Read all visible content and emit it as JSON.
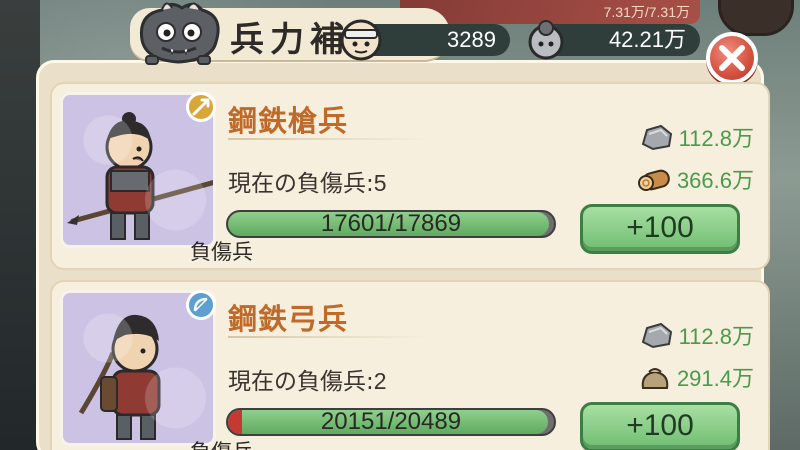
{
  "background": {
    "top_readout": "7.31万/7.31万"
  },
  "header": {
    "title": "兵力補充",
    "resource_a": {
      "icon": "soldier-head-icon",
      "value": "3289"
    },
    "resource_b": {
      "icon": "soldier-group-icon",
      "value": "42.21万"
    }
  },
  "close": {
    "icon": "close-icon"
  },
  "units": [
    {
      "name": "鋼鉄槍兵",
      "type_icon": "spear-badge-icon",
      "wounded_label": "現在の負傷兵:",
      "wounded_value": "5",
      "bar_text": "17601/17869",
      "bar_fraction": 0.985,
      "bar_label": "負傷兵",
      "costs": [
        {
          "icon": "stone-icon",
          "value": "112.8万"
        },
        {
          "icon": "wood-log-icon",
          "value": "366.6万"
        }
      ],
      "button_label": "+100"
    },
    {
      "name": "鋼鉄弓兵",
      "type_icon": "bow-badge-icon",
      "wounded_label": "現在の負傷兵:",
      "wounded_value": "2",
      "bar_text": "20151/20489",
      "bar_fraction": 0.983,
      "bar_label": "負傷兵",
      "costs": [
        {
          "icon": "stone-icon",
          "value": "112.8万"
        },
        {
          "icon": "grain-sack-icon",
          "value": "291.4万"
        }
      ],
      "button_label": "+100"
    }
  ],
  "colors": {
    "unit_name": "#c06a2a",
    "cost_text": "#4b9a4a",
    "bar_fill": "#6fbd71",
    "button_bg": "#8fcf8c",
    "close_bg": "#d4503f",
    "portrait_bg": "#ccc2e4"
  }
}
